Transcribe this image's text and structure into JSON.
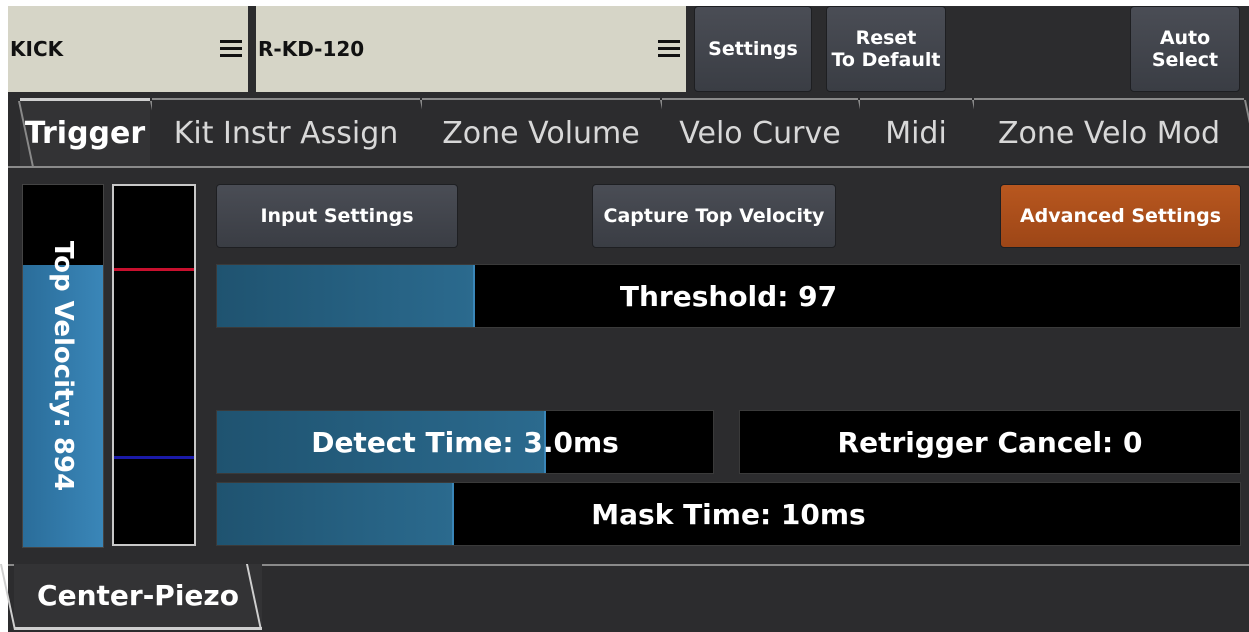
{
  "top_bar": {
    "kit_selector": {
      "label": "KICK"
    },
    "pad_selector": {
      "label": "R-KD-120"
    },
    "settings_label": "Settings",
    "reset_label_line1": "Reset",
    "reset_label_line2": "To Default",
    "auto_label_line1": "Auto",
    "auto_label_line2": "Select"
  },
  "tabs": [
    {
      "label": "Trigger",
      "active": true
    },
    {
      "label": "Kit Instr Assign",
      "active": false
    },
    {
      "label": "Zone Volume",
      "active": false
    },
    {
      "label": "Velo Curve",
      "active": false
    },
    {
      "label": "Midi",
      "active": false
    },
    {
      "label": "Zone Velo Mod",
      "active": false
    }
  ],
  "trigger": {
    "top_velocity_label": "Top Velocity: 894",
    "top_velocity_level_fraction": 0.78,
    "input_settings_label": "Input Settings",
    "capture_label": "Capture Top Velocity",
    "advanced_label": "Advanced Settings",
    "threshold_label": "Threshold: 97",
    "threshold_fill_fraction": 0.25,
    "detect_time_label": "Detect Time: 3.0ms",
    "detect_time_fill_fraction": 0.66,
    "retrigger_label": "Retrigger Cancel: 0",
    "retrigger_fill_fraction": 0.0,
    "mask_time_label": "Mask Time: 10ms",
    "mask_time_fill_fraction": 0.23
  },
  "zone_tab": {
    "label": "Center-Piezo"
  },
  "colors": {
    "accent_blue": "#2b6a8e",
    "advanced_orange": "#b8571f",
    "selector_bg": "#d6d5c7",
    "peak_red": "#c8102e",
    "peak_blue": "#1a1aa8"
  }
}
